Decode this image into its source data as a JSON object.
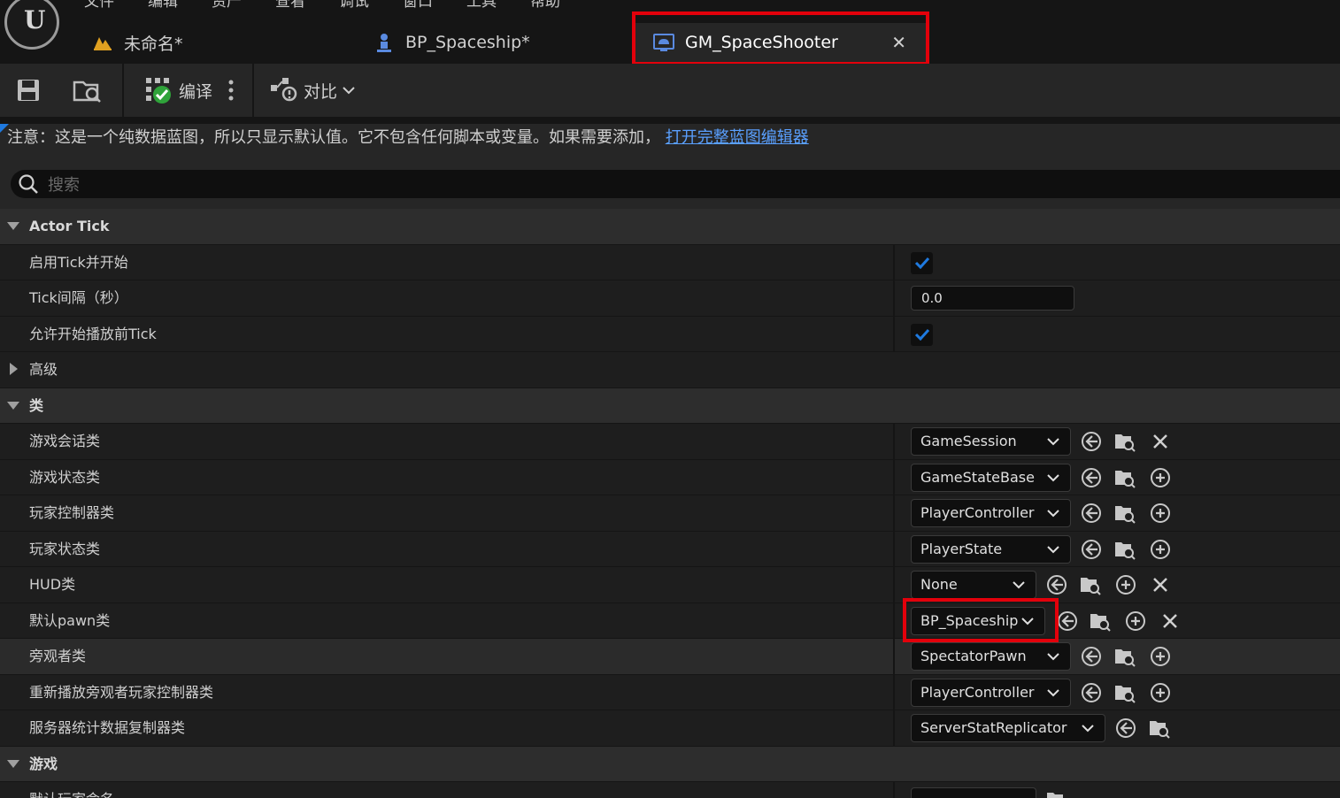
{
  "menu": [
    "文件",
    "编辑",
    "资产",
    "查看",
    "调试",
    "窗口",
    "工具",
    "帮助"
  ],
  "tabs": [
    {
      "label": "未命名*",
      "icon": "level-icon"
    },
    {
      "label": "BP_Spaceship*",
      "icon": "pawn-blueprint-icon"
    },
    {
      "label": "GM_SpaceShooter",
      "icon": "gamemode-blueprint-icon",
      "active": true
    }
  ],
  "toolbar": {
    "compile_label": "编译",
    "diff_label": "对比"
  },
  "notice": {
    "text": "注意：这是一个纯数据蓝图，所以只显示默认值。它不包含任何脚本或变量。如果需要添加，",
    "link": "打开完整蓝图编辑器"
  },
  "search": {
    "placeholder": "搜索"
  },
  "sections": {
    "actor_tick": {
      "title": "Actor Tick",
      "start_with_tick": {
        "label": "启用Tick并开始",
        "checked": true
      },
      "tick_interval": {
        "label": "Tick间隔（秒）",
        "value": "0.0"
      },
      "allow_tick_before_play": {
        "label": "允许开始播放前Tick",
        "checked": true
      },
      "advanced": "高级"
    },
    "classes": {
      "title": "类",
      "game_session": {
        "label": "游戏会话类",
        "value": "GameSession"
      },
      "game_state": {
        "label": "游戏状态类",
        "value": "GameStateBase"
      },
      "player_controller": {
        "label": "玩家控制器类",
        "value": "PlayerController"
      },
      "player_state": {
        "label": "玩家状态类",
        "value": "PlayerState"
      },
      "hud": {
        "label": "HUD类",
        "value": "None"
      },
      "default_pawn": {
        "label": "默认pawn类",
        "value": "BP_Spaceship"
      },
      "spectator": {
        "label": "旁观者类",
        "value": "SpectatorPawn"
      },
      "replay_spectator": {
        "label": "重新播放旁观者玩家控制器类",
        "value": "PlayerController"
      },
      "server_stat": {
        "label": "服务器统计数据复制器类",
        "value": "ServerStatReplicator"
      }
    },
    "game": {
      "title": "游戏",
      "default_player_name": {
        "label": "默认玩家命名"
      }
    }
  },
  "colors": {
    "accent": "#1f7ae0",
    "highlight": "#e3000b",
    "link": "#5aa0ff"
  }
}
